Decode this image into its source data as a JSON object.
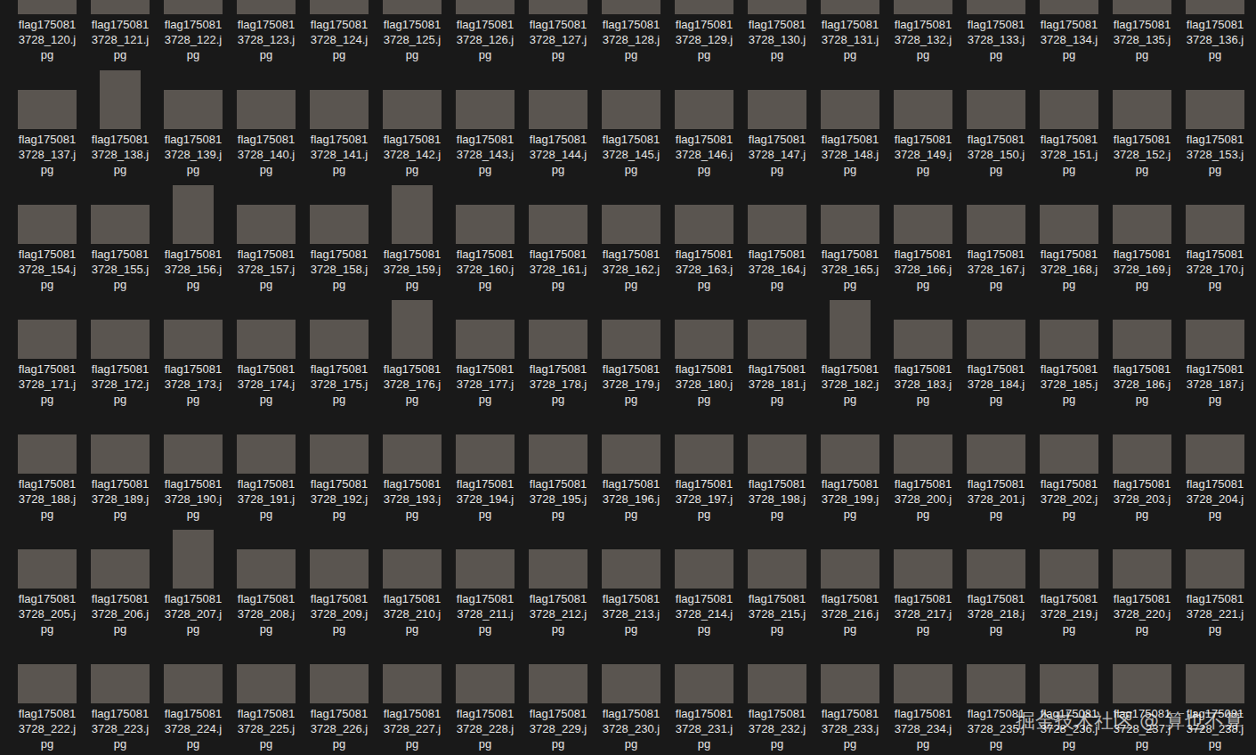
{
  "files": [
    {
      "kind": "landscape",
      "label_lines": [
        "flag175081",
        "3728_120.j",
        "pg"
      ]
    },
    {
      "kind": "landscape",
      "label_lines": [
        "flag175081",
        "3728_121.j",
        "pg"
      ]
    },
    {
      "kind": "landscape",
      "label_lines": [
        "flag175081",
        "3728_122.j",
        "pg"
      ]
    },
    {
      "kind": "landscape",
      "label_lines": [
        "flag175081",
        "3728_123.j",
        "pg"
      ]
    },
    {
      "kind": "landscape",
      "label_lines": [
        "flag175081",
        "3728_124.j",
        "pg"
      ]
    },
    {
      "kind": "landscape",
      "label_lines": [
        "flag175081",
        "3728_125.j",
        "pg"
      ]
    },
    {
      "kind": "landscape",
      "label_lines": [
        "flag175081",
        "3728_126.j",
        "pg"
      ]
    },
    {
      "kind": "landscape",
      "label_lines": [
        "flag175081",
        "3728_127.j",
        "pg"
      ]
    },
    {
      "kind": "landscape",
      "label_lines": [
        "flag175081",
        "3728_128.j",
        "pg"
      ]
    },
    {
      "kind": "landscape",
      "label_lines": [
        "flag175081",
        "3728_129.j",
        "pg"
      ]
    },
    {
      "kind": "landscape",
      "label_lines": [
        "flag175081",
        "3728_130.j",
        "pg"
      ]
    },
    {
      "kind": "landscape",
      "label_lines": [
        "flag175081",
        "3728_131.j",
        "pg"
      ]
    },
    {
      "kind": "landscape",
      "label_lines": [
        "flag175081",
        "3728_132.j",
        "pg"
      ]
    },
    {
      "kind": "landscape",
      "label_lines": [
        "flag175081",
        "3728_133.j",
        "pg"
      ]
    },
    {
      "kind": "landscape",
      "label_lines": [
        "flag175081",
        "3728_134.j",
        "pg"
      ]
    },
    {
      "kind": "landscape",
      "label_lines": [
        "flag175081",
        "3728_135.j",
        "pg"
      ]
    },
    {
      "kind": "landscape",
      "label_lines": [
        "flag175081",
        "3728_136.j",
        "pg"
      ]
    },
    {
      "kind": "landscape",
      "label_lines": [
        "flag175081",
        "3728_137.j",
        "pg"
      ]
    },
    {
      "kind": "portrait",
      "label_lines": [
        "flag175081",
        "3728_138.j",
        "pg"
      ]
    },
    {
      "kind": "landscape",
      "label_lines": [
        "flag175081",
        "3728_139.j",
        "pg"
      ]
    },
    {
      "kind": "landscape",
      "label_lines": [
        "flag175081",
        "3728_140.j",
        "pg"
      ]
    },
    {
      "kind": "landscape",
      "label_lines": [
        "flag175081",
        "3728_141.j",
        "pg"
      ]
    },
    {
      "kind": "landscape",
      "label_lines": [
        "flag175081",
        "3728_142.j",
        "pg"
      ]
    },
    {
      "kind": "landscape",
      "label_lines": [
        "flag175081",
        "3728_143.j",
        "pg"
      ]
    },
    {
      "kind": "landscape",
      "label_lines": [
        "flag175081",
        "3728_144.j",
        "pg"
      ]
    },
    {
      "kind": "landscape",
      "label_lines": [
        "flag175081",
        "3728_145.j",
        "pg"
      ]
    },
    {
      "kind": "landscape",
      "label_lines": [
        "flag175081",
        "3728_146.j",
        "pg"
      ]
    },
    {
      "kind": "landscape",
      "label_lines": [
        "flag175081",
        "3728_147.j",
        "pg"
      ]
    },
    {
      "kind": "landscape",
      "label_lines": [
        "flag175081",
        "3728_148.j",
        "pg"
      ]
    },
    {
      "kind": "landscape",
      "label_lines": [
        "flag175081",
        "3728_149.j",
        "pg"
      ]
    },
    {
      "kind": "landscape",
      "label_lines": [
        "flag175081",
        "3728_150.j",
        "pg"
      ]
    },
    {
      "kind": "landscape",
      "label_lines": [
        "flag175081",
        "3728_151.j",
        "pg"
      ]
    },
    {
      "kind": "landscape",
      "label_lines": [
        "flag175081",
        "3728_152.j",
        "pg"
      ]
    },
    {
      "kind": "landscape",
      "label_lines": [
        "flag175081",
        "3728_153.j",
        "pg"
      ]
    },
    {
      "kind": "landscape",
      "label_lines": [
        "flag175081",
        "3728_154.j",
        "pg"
      ]
    },
    {
      "kind": "landscape",
      "label_lines": [
        "flag175081",
        "3728_155.j",
        "pg"
      ]
    },
    {
      "kind": "portrait",
      "label_lines": [
        "flag175081",
        "3728_156.j",
        "pg"
      ]
    },
    {
      "kind": "landscape",
      "label_lines": [
        "flag175081",
        "3728_157.j",
        "pg"
      ]
    },
    {
      "kind": "landscape",
      "label_lines": [
        "flag175081",
        "3728_158.j",
        "pg"
      ]
    },
    {
      "kind": "portrait",
      "label_lines": [
        "flag175081",
        "3728_159.j",
        "pg"
      ]
    },
    {
      "kind": "landscape",
      "label_lines": [
        "flag175081",
        "3728_160.j",
        "pg"
      ]
    },
    {
      "kind": "landscape",
      "label_lines": [
        "flag175081",
        "3728_161.j",
        "pg"
      ]
    },
    {
      "kind": "landscape",
      "label_lines": [
        "flag175081",
        "3728_162.j",
        "pg"
      ]
    },
    {
      "kind": "landscape",
      "label_lines": [
        "flag175081",
        "3728_163.j",
        "pg"
      ]
    },
    {
      "kind": "landscape",
      "label_lines": [
        "flag175081",
        "3728_164.j",
        "pg"
      ]
    },
    {
      "kind": "landscape",
      "label_lines": [
        "flag175081",
        "3728_165.j",
        "pg"
      ]
    },
    {
      "kind": "landscape",
      "label_lines": [
        "flag175081",
        "3728_166.j",
        "pg"
      ]
    },
    {
      "kind": "landscape",
      "label_lines": [
        "flag175081",
        "3728_167.j",
        "pg"
      ]
    },
    {
      "kind": "landscape",
      "label_lines": [
        "flag175081",
        "3728_168.j",
        "pg"
      ]
    },
    {
      "kind": "landscape",
      "label_lines": [
        "flag175081",
        "3728_169.j",
        "pg"
      ]
    },
    {
      "kind": "landscape",
      "label_lines": [
        "flag175081",
        "3728_170.j",
        "pg"
      ]
    },
    {
      "kind": "landscape",
      "label_lines": [
        "flag175081",
        "3728_171.j",
        "pg"
      ]
    },
    {
      "kind": "landscape",
      "label_lines": [
        "flag175081",
        "3728_172.j",
        "pg"
      ]
    },
    {
      "kind": "landscape",
      "label_lines": [
        "flag175081",
        "3728_173.j",
        "pg"
      ]
    },
    {
      "kind": "landscape",
      "label_lines": [
        "flag175081",
        "3728_174.j",
        "pg"
      ]
    },
    {
      "kind": "landscape",
      "label_lines": [
        "flag175081",
        "3728_175.j",
        "pg"
      ]
    },
    {
      "kind": "portrait",
      "label_lines": [
        "flag175081",
        "3728_176.j",
        "pg"
      ]
    },
    {
      "kind": "landscape",
      "label_lines": [
        "flag175081",
        "3728_177.j",
        "pg"
      ]
    },
    {
      "kind": "landscape",
      "label_lines": [
        "flag175081",
        "3728_178.j",
        "pg"
      ]
    },
    {
      "kind": "landscape",
      "label_lines": [
        "flag175081",
        "3728_179.j",
        "pg"
      ]
    },
    {
      "kind": "landscape",
      "label_lines": [
        "flag175081",
        "3728_180.j",
        "pg"
      ]
    },
    {
      "kind": "landscape",
      "label_lines": [
        "flag175081",
        "3728_181.j",
        "pg"
      ]
    },
    {
      "kind": "portrait",
      "label_lines": [
        "flag175081",
        "3728_182.j",
        "pg"
      ]
    },
    {
      "kind": "landscape",
      "label_lines": [
        "flag175081",
        "3728_183.j",
        "pg"
      ]
    },
    {
      "kind": "landscape",
      "label_lines": [
        "flag175081",
        "3728_184.j",
        "pg"
      ]
    },
    {
      "kind": "landscape",
      "label_lines": [
        "flag175081",
        "3728_185.j",
        "pg"
      ]
    },
    {
      "kind": "landscape",
      "label_lines": [
        "flag175081",
        "3728_186.j",
        "pg"
      ]
    },
    {
      "kind": "landscape",
      "label_lines": [
        "flag175081",
        "3728_187.j",
        "pg"
      ]
    },
    {
      "kind": "landscape",
      "label_lines": [
        "flag175081",
        "3728_188.j",
        "pg"
      ]
    },
    {
      "kind": "landscape",
      "label_lines": [
        "flag175081",
        "3728_189.j",
        "pg"
      ]
    },
    {
      "kind": "landscape",
      "label_lines": [
        "flag175081",
        "3728_190.j",
        "pg"
      ]
    },
    {
      "kind": "landscape",
      "label_lines": [
        "flag175081",
        "3728_191.j",
        "pg"
      ]
    },
    {
      "kind": "landscape",
      "label_lines": [
        "flag175081",
        "3728_192.j",
        "pg"
      ]
    },
    {
      "kind": "landscape",
      "label_lines": [
        "flag175081",
        "3728_193.j",
        "pg"
      ]
    },
    {
      "kind": "landscape",
      "label_lines": [
        "flag175081",
        "3728_194.j",
        "pg"
      ]
    },
    {
      "kind": "landscape",
      "label_lines": [
        "flag175081",
        "3728_195.j",
        "pg"
      ]
    },
    {
      "kind": "landscape",
      "label_lines": [
        "flag175081",
        "3728_196.j",
        "pg"
      ]
    },
    {
      "kind": "landscape",
      "label_lines": [
        "flag175081",
        "3728_197.j",
        "pg"
      ]
    },
    {
      "kind": "landscape",
      "label_lines": [
        "flag175081",
        "3728_198.j",
        "pg"
      ]
    },
    {
      "kind": "landscape",
      "label_lines": [
        "flag175081",
        "3728_199.j",
        "pg"
      ]
    },
    {
      "kind": "landscape",
      "label_lines": [
        "flag175081",
        "3728_200.j",
        "pg"
      ]
    },
    {
      "kind": "landscape",
      "label_lines": [
        "flag175081",
        "3728_201.j",
        "pg"
      ]
    },
    {
      "kind": "landscape",
      "label_lines": [
        "flag175081",
        "3728_202.j",
        "pg"
      ]
    },
    {
      "kind": "landscape",
      "label_lines": [
        "flag175081",
        "3728_203.j",
        "pg"
      ]
    },
    {
      "kind": "landscape",
      "label_lines": [
        "flag175081",
        "3728_204.j",
        "pg"
      ]
    },
    {
      "kind": "landscape",
      "label_lines": [
        "flag175081",
        "3728_205.j",
        "pg"
      ]
    },
    {
      "kind": "landscape",
      "label_lines": [
        "flag175081",
        "3728_206.j",
        "pg"
      ]
    },
    {
      "kind": "portrait",
      "label_lines": [
        "flag175081",
        "3728_207.j",
        "pg"
      ]
    },
    {
      "kind": "landscape",
      "label_lines": [
        "flag175081",
        "3728_208.j",
        "pg"
      ]
    },
    {
      "kind": "landscape",
      "label_lines": [
        "flag175081",
        "3728_209.j",
        "pg"
      ]
    },
    {
      "kind": "landscape",
      "label_lines": [
        "flag175081",
        "3728_210.j",
        "pg"
      ]
    },
    {
      "kind": "landscape",
      "label_lines": [
        "flag175081",
        "3728_211.j",
        "pg"
      ]
    },
    {
      "kind": "landscape",
      "label_lines": [
        "flag175081",
        "3728_212.j",
        "pg"
      ]
    },
    {
      "kind": "landscape",
      "label_lines": [
        "flag175081",
        "3728_213.j",
        "pg"
      ]
    },
    {
      "kind": "landscape",
      "label_lines": [
        "flag175081",
        "3728_214.j",
        "pg"
      ]
    },
    {
      "kind": "landscape",
      "label_lines": [
        "flag175081",
        "3728_215.j",
        "pg"
      ]
    },
    {
      "kind": "landscape",
      "label_lines": [
        "flag175081",
        "3728_216.j",
        "pg"
      ]
    },
    {
      "kind": "landscape",
      "label_lines": [
        "flag175081",
        "3728_217.j",
        "pg"
      ]
    },
    {
      "kind": "landscape",
      "label_lines": [
        "flag175081",
        "3728_218.j",
        "pg"
      ]
    },
    {
      "kind": "landscape",
      "label_lines": [
        "flag175081",
        "3728_219.j",
        "pg"
      ]
    },
    {
      "kind": "landscape",
      "label_lines": [
        "flag175081",
        "3728_220.j",
        "pg"
      ]
    },
    {
      "kind": "landscape",
      "label_lines": [
        "flag175081",
        "3728_221.j",
        "pg"
      ]
    },
    {
      "kind": "landscape",
      "label_lines": [
        "flag175081",
        "3728_222.j",
        "pg"
      ]
    },
    {
      "kind": "landscape",
      "label_lines": [
        "flag175081",
        "3728_223.j",
        "pg"
      ]
    },
    {
      "kind": "landscape",
      "label_lines": [
        "flag175081",
        "3728_224.j",
        "pg"
      ]
    },
    {
      "kind": "landscape",
      "label_lines": [
        "flag175081",
        "3728_225.j",
        "pg"
      ]
    },
    {
      "kind": "landscape",
      "label_lines": [
        "flag175081",
        "3728_226.j",
        "pg"
      ]
    },
    {
      "kind": "landscape",
      "label_lines": [
        "flag175081",
        "3728_227.j",
        "pg"
      ]
    },
    {
      "kind": "landscape",
      "label_lines": [
        "flag175081",
        "3728_228.j",
        "pg"
      ]
    },
    {
      "kind": "landscape",
      "label_lines": [
        "flag175081",
        "3728_229.j",
        "pg"
      ]
    },
    {
      "kind": "landscape",
      "label_lines": [
        "flag175081",
        "3728_230.j",
        "pg"
      ]
    },
    {
      "kind": "landscape",
      "label_lines": [
        "flag175081",
        "3728_231.j",
        "pg"
      ]
    },
    {
      "kind": "landscape",
      "label_lines": [
        "flag175081",
        "3728_232.j",
        "pg"
      ]
    },
    {
      "kind": "landscape",
      "label_lines": [
        "flag175081",
        "3728_233.j",
        "pg"
      ]
    },
    {
      "kind": "landscape",
      "label_lines": [
        "flag175081",
        "3728_234.j",
        "pg"
      ]
    },
    {
      "kind": "landscape",
      "label_lines": [
        "flag175081",
        "3728_235.j",
        "pg"
      ]
    },
    {
      "kind": "landscape",
      "label_lines": [
        "flag175081",
        "3728_236.j",
        "pg"
      ]
    },
    {
      "kind": "landscape",
      "label_lines": [
        "flag175081",
        "3728_237.j",
        "pg"
      ]
    },
    {
      "kind": "landscape",
      "label_lines": [
        "flag175081",
        "3728_238.j",
        "pg"
      ]
    }
  ],
  "watermark": "掘金技术社区 @ 算也不算"
}
